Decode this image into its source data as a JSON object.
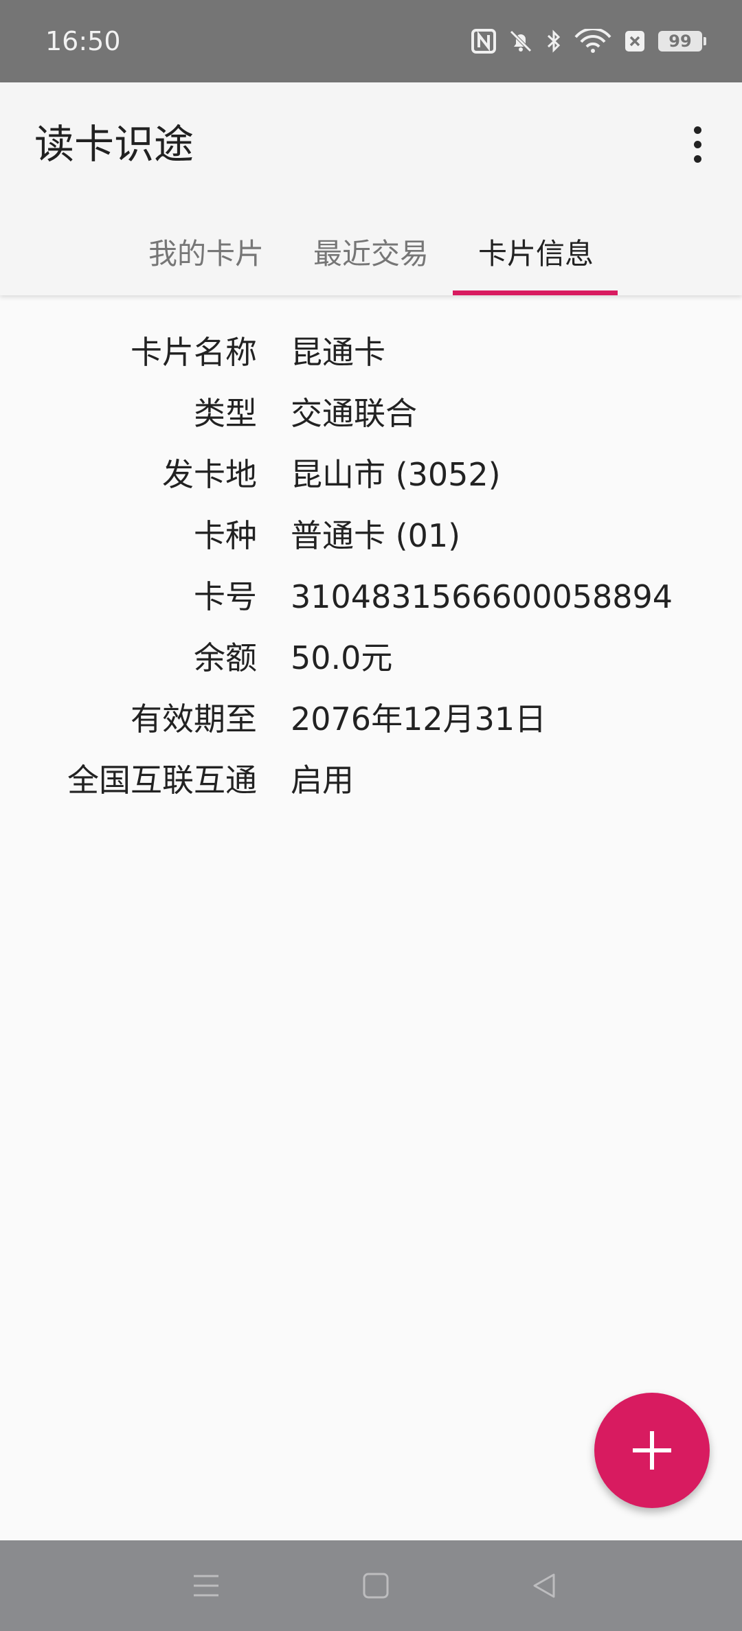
{
  "status_bar": {
    "time": "16:50",
    "battery": "99",
    "icons": [
      "nfc-icon",
      "bell-off-icon",
      "bluetooth-icon",
      "wifi-icon",
      "sim-off-icon",
      "battery-icon"
    ]
  },
  "app_bar": {
    "title": "读卡识途",
    "menu_icon": "more-vert-icon"
  },
  "tabs": [
    {
      "label": "我的卡片",
      "selected": false
    },
    {
      "label": "最近交易",
      "selected": false
    },
    {
      "label": "卡片信息",
      "selected": true
    }
  ],
  "card_info": [
    {
      "label": "卡片名称",
      "value": "昆通卡"
    },
    {
      "label": "类型",
      "value": "交通联合"
    },
    {
      "label": "发卡地",
      "value": "昆山市 (3052)"
    },
    {
      "label": "卡种",
      "value": "普通卡 (01)"
    },
    {
      "label": "卡号",
      "value": "3104831566600058894"
    },
    {
      "label": "余额",
      "value": "50.0元"
    },
    {
      "label": "有效期至",
      "value": "2076年12月31日"
    },
    {
      "label": "全国互联互通",
      "value": "启用"
    }
  ],
  "fab": {
    "icon": "add-icon"
  },
  "nav_bar": {
    "buttons": [
      "menu-icon",
      "home-icon",
      "back-icon"
    ]
  },
  "colors": {
    "accent": "#d81b60",
    "status_bar": "#757575",
    "app_bar": "#f5f5f5",
    "background": "#fafafa",
    "nav_bar": "#8a8b8e"
  }
}
